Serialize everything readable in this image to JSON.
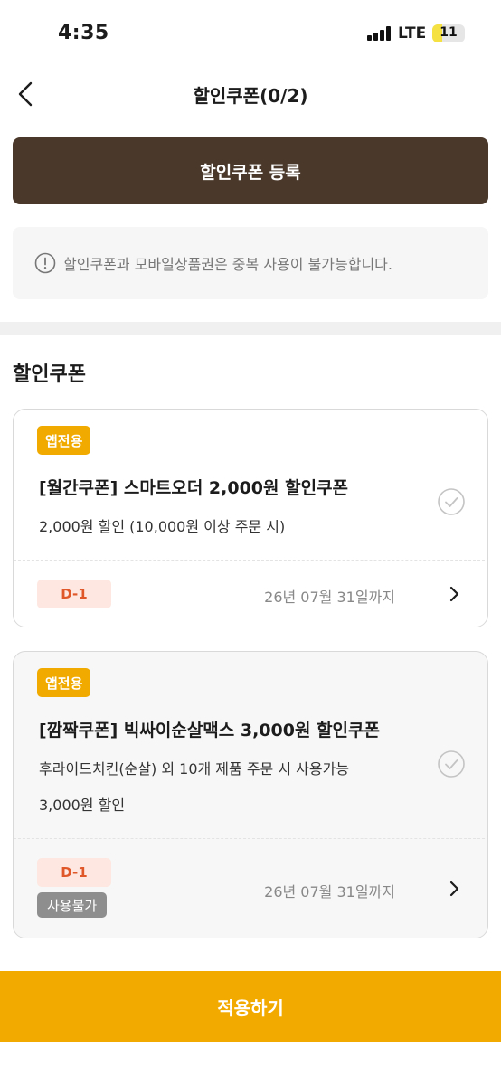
{
  "status_bar": {
    "time": "4:35",
    "network": "LTE",
    "battery": "11",
    "battery_level_percent": 11
  },
  "header": {
    "title": "할인쿠폰(0/2)",
    "back_icon": "chevron-left-icon"
  },
  "register_button": {
    "label": "할인쿠폰 등록"
  },
  "notice": {
    "icon": "info-circle-icon",
    "text": "할인쿠폰과 모바일상품권은 중복 사용이 불가능합니다."
  },
  "section": {
    "title": "할인쿠폰"
  },
  "coupons": [
    {
      "tag": "앱전용",
      "title": "[월간쿠폰] 스마트오더 2,000원 할인쿠폰",
      "desc_lines": [
        "2,000원 할인 (10,000원 이상 주문 시)"
      ],
      "dday": "D-1",
      "expiry": "26년 07월 31일까지",
      "selected": false
    },
    {
      "tag": "앱전용",
      "title": "[깜짝쿠폰] 빅싸이순살맥스 3,000원 할인쿠폰",
      "desc_lines": [
        "후라이드치킨(순살) 외 10개 제품 주문 시 사용가능",
        "3,000원 할인"
      ],
      "dday": "D-1",
      "status": "사용불가",
      "expiry": "26년 07월 31일까지",
      "selected": false
    }
  ],
  "apply_button": {
    "label": "적용하기"
  },
  "colors": {
    "brand_brown": "#4a382a",
    "accent_yellow": "#f2aa00",
    "dday_red": "#e0582a",
    "dday_bg": "#fde7e0",
    "disabled_gray": "#8e8e8e"
  }
}
